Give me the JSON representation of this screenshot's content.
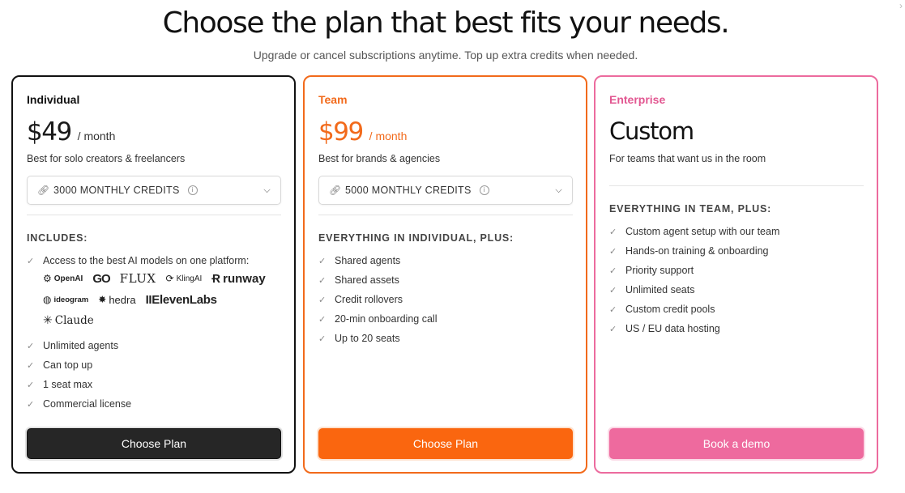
{
  "header": {
    "title": "Choose the plan that best fits your needs.",
    "subtitle": "Upgrade or cancel subscriptions anytime. Top up extra credits when needed."
  },
  "colors": {
    "individual": "#111111",
    "team": "#f26a1b",
    "enterprise": "#ec6b9e"
  },
  "plans": {
    "individual": {
      "name": "Individual",
      "price": "$49",
      "period": "/ month",
      "description": "Best for solo creators & freelancers",
      "credits": "3000 MONTHLY CREDITS",
      "section_title": "INCLUDES:",
      "models_feature": "Access to the best AI models on one platform:",
      "logos": [
        "OpenAI",
        "GO",
        "FLUX",
        "KlingAI",
        "runway",
        "ideogram",
        "hedra",
        "IIElevenLabs",
        "Claude"
      ],
      "features": [
        "Unlimited agents",
        "Can top up",
        "1 seat max",
        "Commercial license"
      ],
      "cta": "Choose Plan"
    },
    "team": {
      "name": "Team",
      "price": "$99",
      "period": "/ month",
      "description": "Best for brands & agencies",
      "credits": "5000 MONTHLY CREDITS",
      "section_title": "EVERYTHING IN INDIVIDUAL, PLUS:",
      "features": [
        "Shared agents",
        "Shared assets",
        "Credit rollovers",
        "20-min onboarding call",
        "Up to 20 seats"
      ],
      "cta": "Choose Plan"
    },
    "enterprise": {
      "name": "Enterprise",
      "price": "Custom",
      "description": "For teams that want us in the room",
      "section_title": "EVERYTHING IN TEAM, PLUS:",
      "features": [
        "Custom agent setup with our team",
        "Hands-on training & onboarding",
        "Priority support",
        "Unlimited seats",
        "Custom credit pools",
        "US / EU data hosting"
      ],
      "cta": "Book a demo"
    }
  }
}
